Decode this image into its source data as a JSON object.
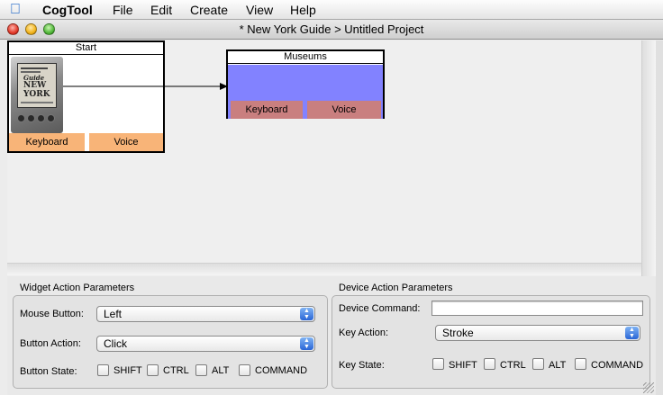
{
  "menubar": {
    "apple_icon": "apple-icon",
    "app_name": "CogTool",
    "items": [
      "File",
      "Edit",
      "Create",
      "View",
      "Help"
    ]
  },
  "window": {
    "title": "* New York Guide > Untitled Project"
  },
  "canvas": {
    "frames": [
      {
        "title": "Start",
        "device_buttons": [
          "Keyboard",
          "Voice"
        ],
        "screen_text": [
          "Guide",
          "NEW",
          "YORK"
        ]
      },
      {
        "title": "Museums",
        "device_buttons": [
          "Keyboard",
          "Voice"
        ]
      }
    ],
    "colors": {
      "widget_fill": "#8282ff",
      "start_button": "#f8b478",
      "museums_button": "#c97f7f"
    }
  },
  "widget_params": {
    "title": "Widget Action Parameters",
    "mouse_button_label": "Mouse Button:",
    "mouse_button_value": "Left",
    "button_action_label": "Button Action:",
    "button_action_value": "Click",
    "button_state_label": "Button State:",
    "modifiers": [
      "SHIFT",
      "CTRL",
      "ALT",
      "COMMAND"
    ]
  },
  "device_params": {
    "title": "Device Action Parameters",
    "device_command_label": "Device Command:",
    "device_command_value": "",
    "key_action_label": "Key Action:",
    "key_action_value": "Stroke",
    "key_state_label": "Key State:",
    "modifiers": [
      "SHIFT",
      "CTRL",
      "ALT",
      "COMMAND"
    ]
  }
}
